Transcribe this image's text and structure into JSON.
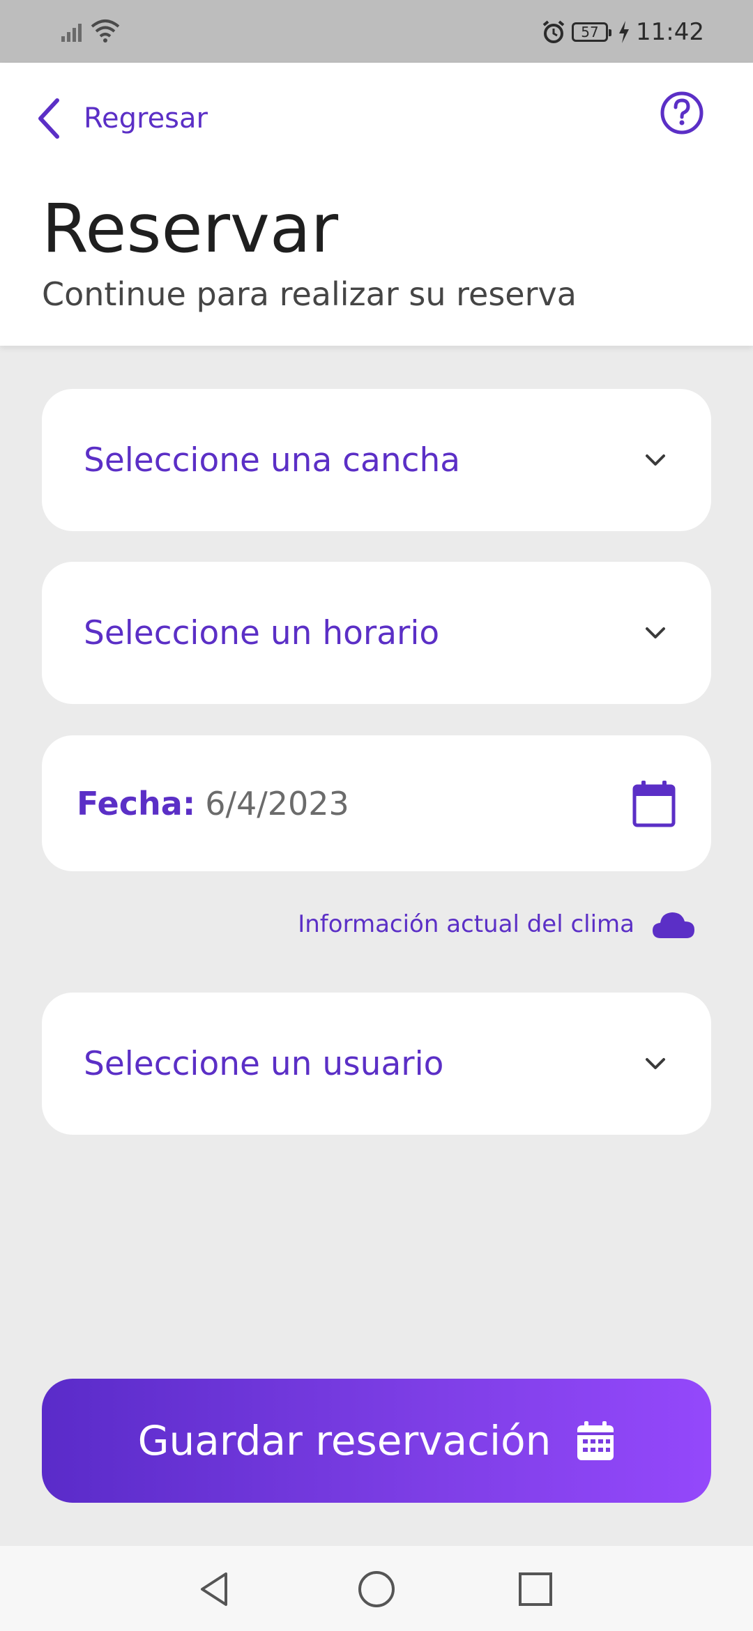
{
  "status_bar": {
    "battery_level": "57",
    "time": "11:42",
    "icons": [
      "signal-icon",
      "wifi-icon",
      "alarm-icon",
      "battery-icon",
      "charging-icon"
    ]
  },
  "header": {
    "back_label": "Regresar",
    "title": "Reservar",
    "subtitle": "Continue para realizar su reserva",
    "help_icon": "question-circle-icon"
  },
  "form": {
    "cancha_placeholder": "Seleccione una cancha",
    "horario_placeholder": "Seleccione un horario",
    "fecha_label": "Fecha:",
    "fecha_value": "6/4/2023",
    "weather_link": "Información actual del clima",
    "usuario_placeholder": "Seleccione un usuario"
  },
  "actions": {
    "save_label": "Guardar reservación"
  },
  "colors": {
    "accent": "#5b2fc6",
    "button_gradient_start": "#5a2bc9",
    "button_gradient_end": "#9448fb",
    "background": "#ebebeb"
  }
}
